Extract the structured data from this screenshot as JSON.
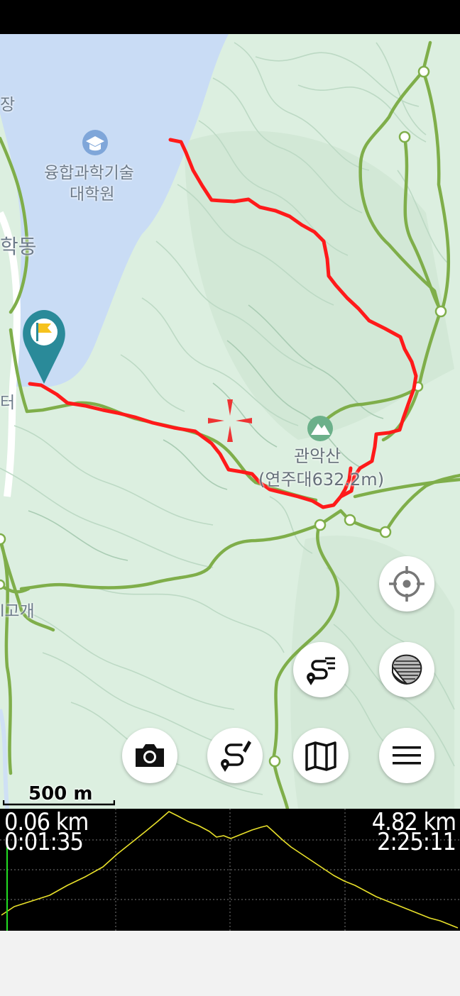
{
  "map": {
    "labels": {
      "institute_line1": "융합과학기술",
      "institute_line2": "대학원",
      "left_partial_1": "장",
      "left_partial_2": "학동",
      "left_partial_3": "터",
      "left_partial_4": "l고개",
      "peak_name": "관악산",
      "peak_detail": "(연주대632.2m)",
      "scale": "500 m"
    },
    "track_color": "#ff1a1a",
    "trail_color": "#7fae4a",
    "water_color": "#c9dcf5",
    "icons": [
      "start-flag-pin-icon",
      "crosshair-icon",
      "education-poi-icon",
      "mountain-poi-icon"
    ]
  },
  "buttons": {
    "my_location": "my-location-icon",
    "map_layers": "layers-icon",
    "route": "route-list-icon",
    "camera": "camera-icon",
    "draw_route": "draw-route-icon",
    "maps": "map-icon",
    "menu": "menu-icon"
  },
  "elevation_profile": {
    "distance_current": "0.06 km",
    "time_current": "0:01:35",
    "distance_total": "4.82 km",
    "time_total": "2:25:11",
    "line_color": "#e8e02a",
    "cursor_color": "#22dd22"
  }
}
